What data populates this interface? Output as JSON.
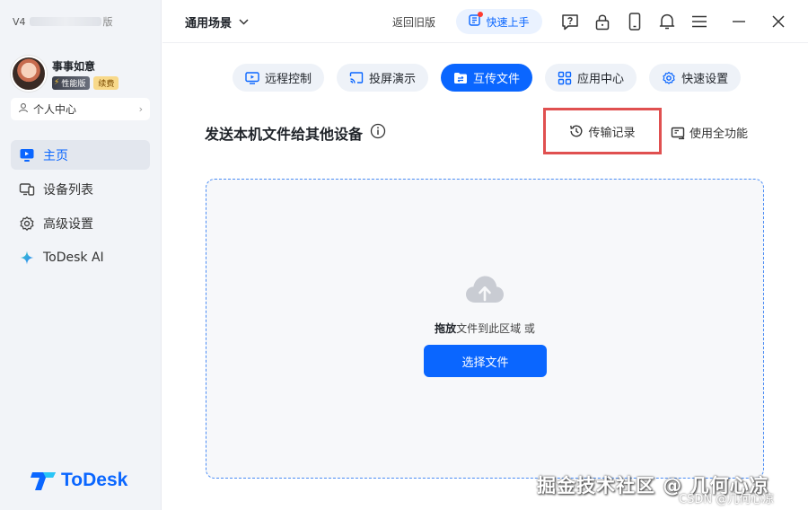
{
  "sidebar": {
    "version_prefix": "V4",
    "version_suffix": "版",
    "username": "事事如意",
    "badge_perf": "性能版",
    "badge_renew": "续费",
    "personal_center": "个人中心",
    "nav": [
      {
        "label": "主页",
        "icon": "monitor-icon",
        "active": true
      },
      {
        "label": "设备列表",
        "icon": "devices-icon",
        "active": false
      },
      {
        "label": "高级设置",
        "icon": "gear-icon",
        "active": false
      },
      {
        "label": "ToDesk AI",
        "icon": "sparkle-icon",
        "active": false
      }
    ],
    "logo_text": "ToDesk"
  },
  "topbar": {
    "scene": "通用场景",
    "back_old": "返回旧版",
    "quick_start": "快速上手",
    "icons": [
      "help-icon",
      "lock-icon",
      "phone-icon",
      "bell-icon",
      "menu-icon"
    ],
    "window": [
      "minimize-icon",
      "close-icon"
    ]
  },
  "tabs": [
    {
      "label": "远程控制",
      "icon": "remote-control-icon",
      "active": false
    },
    {
      "label": "投屏演示",
      "icon": "cast-icon",
      "active": false
    },
    {
      "label": "互传文件",
      "icon": "file-transfer-icon",
      "active": true
    },
    {
      "label": "应用中心",
      "icon": "apps-icon",
      "active": false
    },
    {
      "label": "快速设置",
      "icon": "settings-icon",
      "active": false
    }
  ],
  "content": {
    "title": "发送本机文件给其他设备",
    "history": "传输记录",
    "full_function": "使用全功能",
    "drop_bold": "拖放",
    "drop_text": "文件到此区域 或",
    "select_button": "选择文件"
  },
  "watermark": {
    "main": "掘金技术社区 @ 几何心凉",
    "sub": "CSDN @几何心凉"
  },
  "colors": {
    "accent": "#0a66ff",
    "highlight_border": "#e05050"
  }
}
